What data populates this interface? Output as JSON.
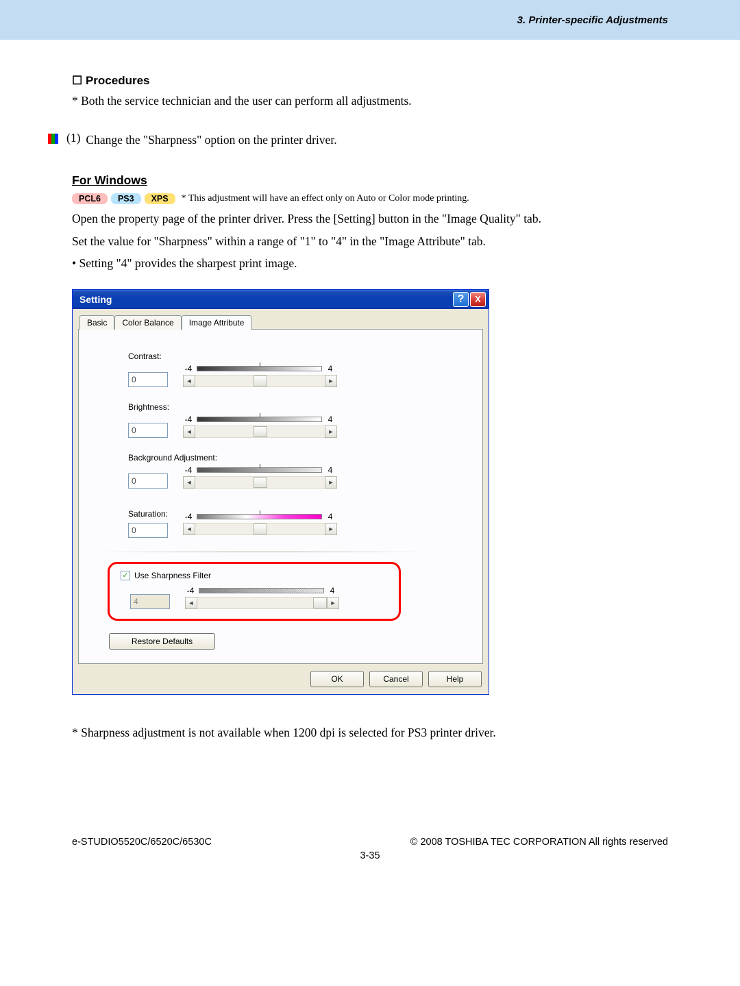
{
  "header": {
    "section": "3. Printer-specific Adjustments"
  },
  "content": {
    "procedures_heading": "☐ Procedures",
    "procedures_note": "* Both the service technician and the user can perform all adjustments.",
    "step_number": "(1)",
    "step_text": "Change the \"Sharpness\" option on the printer driver.",
    "for_windows": "For Windows",
    "badges": {
      "pcl6": "PCL6",
      "ps3": "PS3",
      "xps": "XPS",
      "note": "* This adjustment will have an effect only on Auto or Color mode printing."
    },
    "para1": "Open the property page of the printer driver.  Press the [Setting] button in the \"Image Quality\" tab.",
    "para2": "Set the value for \"Sharpness\" within a range of \"1\" to \"4\" in the \"Image Attribute\" tab.",
    "bullet1": "• Setting \"4\" provides the sharpest print image.",
    "post_note": "* Sharpness adjustment is not available when 1200 dpi is selected for PS3 printer driver."
  },
  "dialog": {
    "title": "Setting",
    "tabs": {
      "basic": "Basic",
      "color_balance": "Color Balance",
      "image_attribute": "Image Attribute"
    },
    "labels": {
      "contrast": "Contrast:",
      "brightness": "Brightness:",
      "background": "Background Adjustment:",
      "saturation": "Saturation:",
      "use_sharpness": "Use Sharpness Filter",
      "restore": "Restore Defaults"
    },
    "values": {
      "contrast": "0",
      "brightness": "0",
      "background": "0",
      "saturation": "0",
      "sharpness": "4",
      "scale_min": "-4",
      "scale_max": "4"
    },
    "buttons": {
      "ok": "OK",
      "cancel": "Cancel",
      "help": "Help"
    },
    "checkbox_check": "✓",
    "arrows": {
      "left": "◄",
      "right": "►"
    },
    "help_glyph": "?",
    "close_glyph": "X"
  },
  "footer": {
    "left": "e-STUDIO5520C/6520C/6530C",
    "right": "© 2008 TOSHIBA TEC CORPORATION All rights reserved",
    "page": "3-35"
  }
}
